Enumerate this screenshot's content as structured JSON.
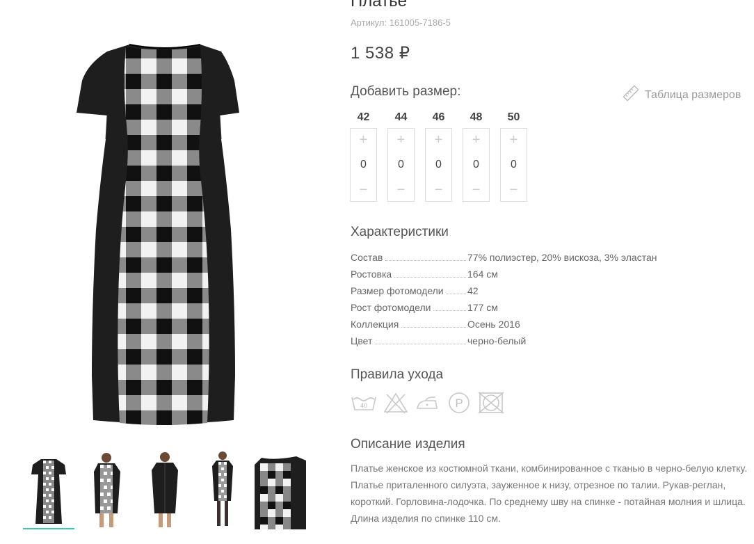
{
  "product": {
    "title": "Платье",
    "sku": "Артикул: 161005-7186-5",
    "price": "1 538 ₽"
  },
  "sizes": {
    "heading": "Добавить размер:",
    "table_link": "Таблица размеров",
    "items": [
      {
        "label": "42",
        "qty": "0"
      },
      {
        "label": "44",
        "qty": "0"
      },
      {
        "label": "46",
        "qty": "0"
      },
      {
        "label": "48",
        "qty": "0"
      },
      {
        "label": "50",
        "qty": "0"
      }
    ],
    "plus": "+",
    "minus": "−"
  },
  "characteristics": {
    "heading": "Характеристики",
    "rows": [
      {
        "key": "Состав",
        "value": "77% полиэстер, 20% вискоза, 3% эластан"
      },
      {
        "key": "Ростовка",
        "value": "164 см"
      },
      {
        "key": "Размер фотомодели",
        "value": "42"
      },
      {
        "key": "Рост фотомодели",
        "value": "177 см"
      },
      {
        "key": "Коллекция",
        "value": "Осень 2016"
      },
      {
        "key": "Цвет",
        "value": "черно-белый"
      }
    ]
  },
  "care": {
    "heading": "Правила ухода",
    "icons": [
      "wash-40-icon",
      "no-bleach-icon",
      "iron-low-icon",
      "dry-clean-p-icon",
      "no-tumble-dry-icon"
    ],
    "wash_temp": "40",
    "dry_clean_letter": "P"
  },
  "description": {
    "heading": "Описание изделия",
    "paragraph": "Платье женское из костюмной ткани, комбинированное с тканью в черно-белую клетку. Платье приталенного силуэта, зауженное к низу, отрезное по талии. Рукав-реглан, короткий. Горловина-лодочка. По среднему шву на спинке - потайная молния и шлица.",
    "length": "Длина изделия по спинке 110 см."
  },
  "gallery": {
    "thumbnails": [
      "front",
      "model-front",
      "back",
      "model-full",
      "detail"
    ],
    "active_index": 0
  },
  "colors": {
    "accent": "#3cc7b4",
    "dress_black": "#1e1e1e",
    "check_white": "#f2f2f2",
    "check_gray": "#8a8a8a"
  }
}
